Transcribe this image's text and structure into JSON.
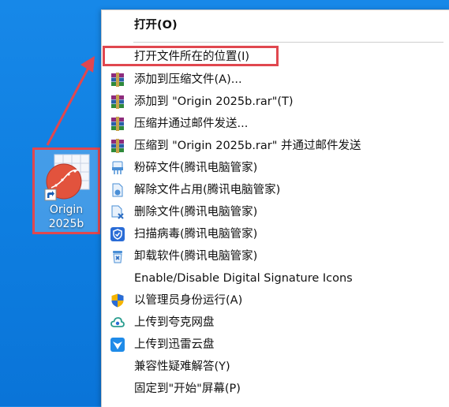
{
  "desktop": {
    "shortcut": {
      "label_line1": "Origin",
      "label_line2": "2025b",
      "icon": "origin-app-icon"
    }
  },
  "context_menu": {
    "items": [
      {
        "label": "打开(O)",
        "icon": "",
        "bold": true
      },
      {
        "label": "打开文件所在的位置(I)",
        "icon": "",
        "highlighted": true
      },
      {
        "label": "添加到压缩文件(A)...",
        "icon": "winrar-icon"
      },
      {
        "label": "添加到 \"Origin 2025b.rar\"(T)",
        "icon": "winrar-icon"
      },
      {
        "label": "压缩并通过邮件发送...",
        "icon": "winrar-icon"
      },
      {
        "label": "压缩到 \"Origin 2025b.rar\" 并通过邮件发送",
        "icon": "winrar-icon"
      },
      {
        "label": "粉碎文件(腾讯电脑管家)",
        "icon": "shred-icon"
      },
      {
        "label": "解除文件占用(腾讯电脑管家)",
        "icon": "unlock-file-icon"
      },
      {
        "label": "删除文件(腾讯电脑管家)",
        "icon": "delete-file-icon"
      },
      {
        "label": "扫描病毒(腾讯电脑管家)",
        "icon": "shield-scan-icon"
      },
      {
        "label": "卸载软件(腾讯电脑管家)",
        "icon": "uninstall-icon"
      },
      {
        "label": "Enable/Disable Digital Signature Icons",
        "icon": ""
      },
      {
        "label": "以管理员身份运行(A)",
        "icon": "uac-shield-icon"
      },
      {
        "label": "上传到夸克网盘",
        "icon": "quark-cloud-icon"
      },
      {
        "label": "上传到迅雷云盘",
        "icon": "xunlei-cloud-icon"
      },
      {
        "label": "兼容性疑难解答(Y)",
        "icon": ""
      },
      {
        "label": "固定到\"开始\"屏幕(P)",
        "icon": ""
      }
    ]
  },
  "colors": {
    "desktop_bg": "#0e7ee0",
    "annotation_red": "#e0474f",
    "menu_bg": "#ffffff"
  }
}
